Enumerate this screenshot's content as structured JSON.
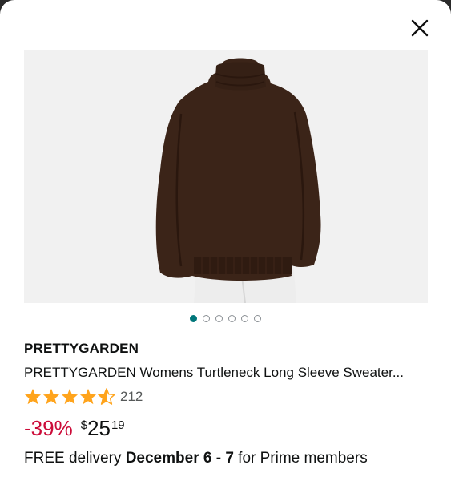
{
  "close": {
    "icon": "close-icon"
  },
  "product": {
    "image_alt": "Brown turtleneck sweater worn by a model",
    "carousel": {
      "total": 6,
      "active": 1
    },
    "brand": "PRETTYGARDEN",
    "title": "PRETTYGARDEN Womens Turtleneck Long Sleeve Sweater...",
    "rating": {
      "stars": 4.5,
      "count": "212"
    },
    "discount": "-39%",
    "price": {
      "currency": "$",
      "whole": "25",
      "fraction": "19"
    },
    "delivery": {
      "prefix": "FREE delivery ",
      "dates": "December 6 - 7",
      "suffix": " for Prime members"
    }
  },
  "colors": {
    "star": "#ffa41c",
    "discount": "#cc0c39",
    "dot_active": "#00767a"
  }
}
